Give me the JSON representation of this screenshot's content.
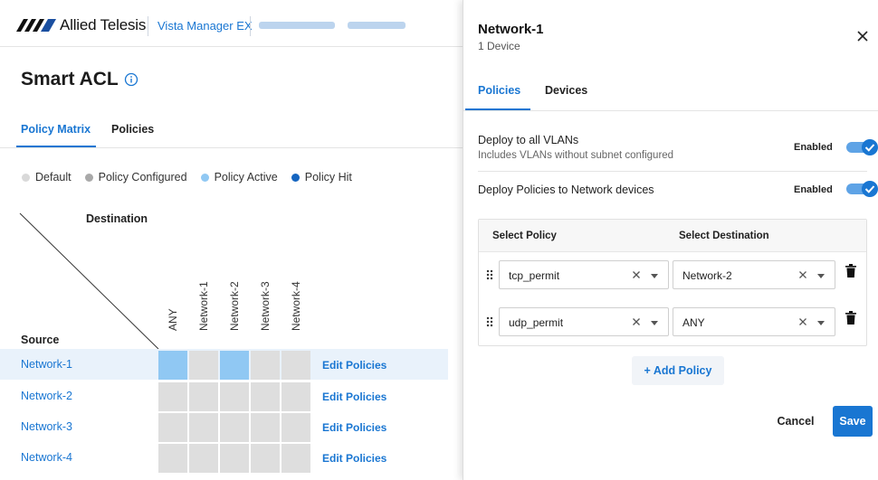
{
  "header": {
    "brand": "Allied Telesis",
    "product": "Vista Manager EX"
  },
  "page": {
    "title": "Smart ACL",
    "tabs": [
      {
        "label": "Policy Matrix",
        "active": true
      },
      {
        "label": "Policies",
        "active": false
      }
    ]
  },
  "legend": [
    {
      "label": "Default",
      "color": "#d9d9d9"
    },
    {
      "label": "Policy Configured",
      "color": "#a9a9a9"
    },
    {
      "label": "Policy Active",
      "color": "#90c8f3"
    },
    {
      "label": "Policy Hit",
      "color": "#1565c0"
    }
  ],
  "matrix": {
    "destination_label": "Destination",
    "source_label": "Source",
    "columns": [
      "ANY",
      "Network-1",
      "Network-2",
      "Network-3",
      "Network-4"
    ],
    "edit_label": "Edit Policies",
    "rows": [
      {
        "name": "Network-1",
        "selected": true,
        "cells": [
          "active",
          "default",
          "active",
          "default",
          "default"
        ]
      },
      {
        "name": "Network-2",
        "selected": false,
        "cells": [
          "default",
          "default",
          "default",
          "default",
          "default"
        ]
      },
      {
        "name": "Network-3",
        "selected": false,
        "cells": [
          "default",
          "default",
          "default",
          "default",
          "default"
        ]
      },
      {
        "name": "Network-4",
        "selected": false,
        "cells": [
          "default",
          "default",
          "default",
          "default",
          "default"
        ]
      }
    ]
  },
  "panel": {
    "title": "Network-1",
    "subtitle": "1 Device",
    "tabs": [
      {
        "label": "Policies",
        "active": true
      },
      {
        "label": "Devices",
        "active": false
      }
    ],
    "deploy_all_vlans": {
      "title": "Deploy to all VLANs",
      "description": "Includes VLANs without subnet configured",
      "state_label": "Enabled",
      "on": true
    },
    "deploy_network_devices": {
      "title": "Deploy Policies to Network devices",
      "state_label": "Enabled",
      "on": true
    },
    "policy_table": {
      "col_policy": "Select Policy",
      "col_destination": "Select Destination",
      "rows": [
        {
          "policy": "tcp_permit",
          "destination": "Network-2"
        },
        {
          "policy": "udp_permit",
          "destination": "ANY"
        }
      ]
    },
    "add_policy_label": "+ Add Policy",
    "cancel_label": "Cancel",
    "save_label": "Save"
  },
  "colors": {
    "accent": "#1976d2",
    "cell_default": "#dedede",
    "cell_active": "#90c8f3",
    "row_highlight": "#e9f2fb"
  }
}
